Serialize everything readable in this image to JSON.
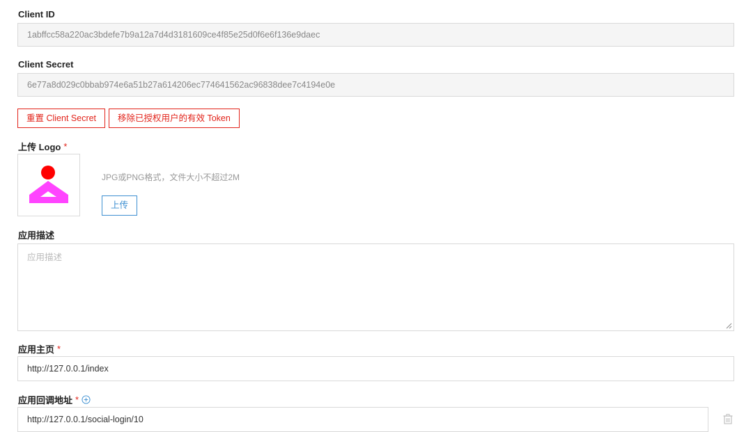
{
  "client_id": {
    "label": "Client ID",
    "value": "1abffcc58a220ac3bdefe7b9a12a7d4d3181609ce4f85e25d0f6e6f136e9daec"
  },
  "client_secret": {
    "label": "Client Secret",
    "value": "6e77a8d029c0bbab974e6a51b27a614206ec774641562ac96838dee7c4194e0e"
  },
  "actions": {
    "reset_secret": "重置 Client Secret",
    "revoke_tokens": "移除已授权用户的有效 Token"
  },
  "logo": {
    "label": "上传 Logo",
    "required_mark": "*",
    "hint": "JPG或PNG格式，文件大小不超过2M",
    "upload_button": "上传",
    "colors": {
      "circle": "#ff0000",
      "shape": "#ff44ff"
    }
  },
  "description": {
    "label": "应用描述",
    "placeholder": "应用描述",
    "value": ""
  },
  "homepage": {
    "label": "应用主页",
    "required_mark": "*",
    "value": "http://127.0.0.1/index"
  },
  "callback": {
    "label": "应用回调地址",
    "required_mark": "*",
    "add_icon": "plus-circle-icon",
    "value": "http://127.0.0.1/social-login/10",
    "delete_icon": "trash-icon"
  },
  "colors": {
    "danger": "#e2231a",
    "primary": "#3d8fd1",
    "readonly_bg": "#f5f5f5",
    "border": "#d9d9d9"
  }
}
